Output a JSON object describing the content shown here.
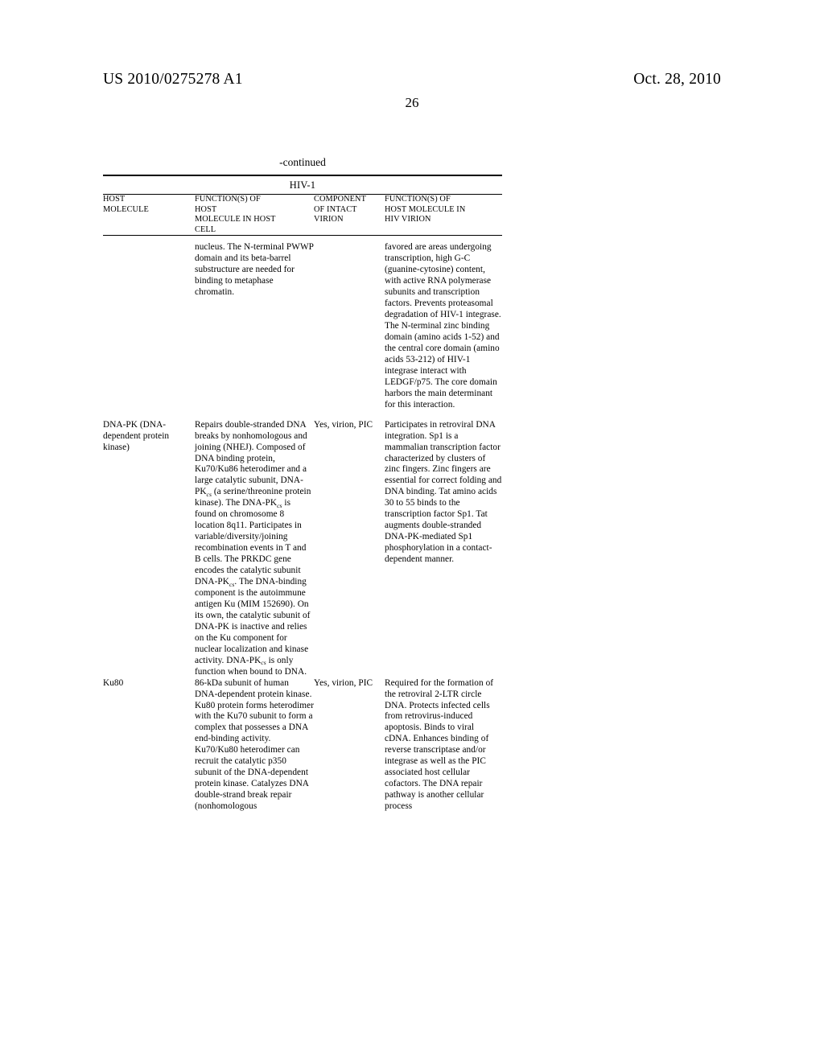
{
  "header": {
    "publication_number": "US 2010/0275278 A1",
    "publication_date": "Oct. 28, 2010",
    "page_number": "26"
  },
  "table": {
    "continued_label": "-continued",
    "group_title": "HIV-1",
    "columns": [
      {
        "id": "host_molecule",
        "header": "HOST\nMOLECULE"
      },
      {
        "id": "function_host_cell",
        "header": "FUNCTION(S) OF\nHOST\nMOLECULE IN HOST\nCELL"
      },
      {
        "id": "component_virion",
        "header": "COMPONENT\nOF INTACT\nVIRION"
      },
      {
        "id": "function_hiv_virion",
        "header": "FUNCTION(S) OF\nHOST MOLECULE IN\nHIV VIRION"
      }
    ],
    "header_lines": {
      "c1": [
        "HOST",
        "MOLECULE"
      ],
      "c2": [
        "FUNCTION(S) OF",
        "HOST",
        "MOLECULE IN HOST",
        "CELL"
      ],
      "c3": [
        "COMPONENT",
        "OF INTACT",
        "VIRION"
      ],
      "c4": [
        "FUNCTION(S) OF",
        "HOST MOLECULE IN",
        "HIV VIRION"
      ]
    },
    "rows": [
      {
        "host_molecule": "",
        "function_host_cell": "nucleus. The N-terminal PWWP domain and its beta-barrel substructure are needed for binding to metaphase chromatin.",
        "component_virion": "",
        "function_hiv_virion": "favored are areas undergoing transcription, high G-C (guanine-cytosine) content, with active RNA polymerase subunits and transcription factors. Prevents proteasomal degradation of HIV-1 integrase. The N-terminal zinc binding domain (amino acids 1-52) and the central core domain (amino acids 53-212) of HIV-1 integrase interact with LEDGF/p75. The core domain harbors the main determinant for this interaction."
      },
      {
        "host_molecule": "DNA-PK (DNA-dependent protein kinase)",
        "function_host_cell": "Repairs double-stranded DNA breaks by nonhomologous and joining (NHEJ). Composed of DNA binding protein, Ku70/Ku86 heterodimer and a large catalytic subunit, DNA-PKcs (a serine/threonine protein kinase). The DNA-PKcs is found on chromosome 8 location 8q11. Participates in variable/diversity/joining recombination events in T and B cells. The PRKDC gene encodes the catalytic subunit DNA-PKcs. The DNA-binding component is the autoimmune antigen Ku (MIM 152690). On its own, the catalytic subunit of DNA-PK is inactive and relies on the Ku component for nuclear localization and kinase activity. DNA-PKcs is only function when bound to DNA.",
        "component_virion": "Yes, virion, PIC",
        "function_hiv_virion": "Participates in retroviral DNA integration. Sp1 is a mammalian transcription factor characterized by clusters of zinc fingers. Zinc fingers are essential for correct folding and DNA binding. Tat amino acids 30 to 55 binds to the transcription factor Sp1. Tat augments double-stranded DNA-PK-mediated Sp1 phosphorylation in a contact-dependent manner."
      },
      {
        "host_molecule": "Ku80",
        "function_host_cell": "86-kDa subunit of human DNA-dependent protein kinase. Ku80 protein forms heterodimer with the Ku70 subunit to form a complex that possesses a DNA end-binding activity. Ku70/Ku80 heterodimer can recruit the catalytic p350 subunit of the DNA-dependent protein kinase. Catalyzes DNA double-strand break repair (nonhomologous",
        "component_virion": "Yes, virion, PIC",
        "function_hiv_virion": "Required for the formation of the retroviral 2-LTR circle DNA. Protects infected cells from retrovirus-induced apoptosis. Binds to viral cDNA. Enhances binding of reverse transcriptase and/or integrase as well as the PIC associated host cellular cofactors. The DNA repair pathway is another cellular process"
      }
    ]
  }
}
